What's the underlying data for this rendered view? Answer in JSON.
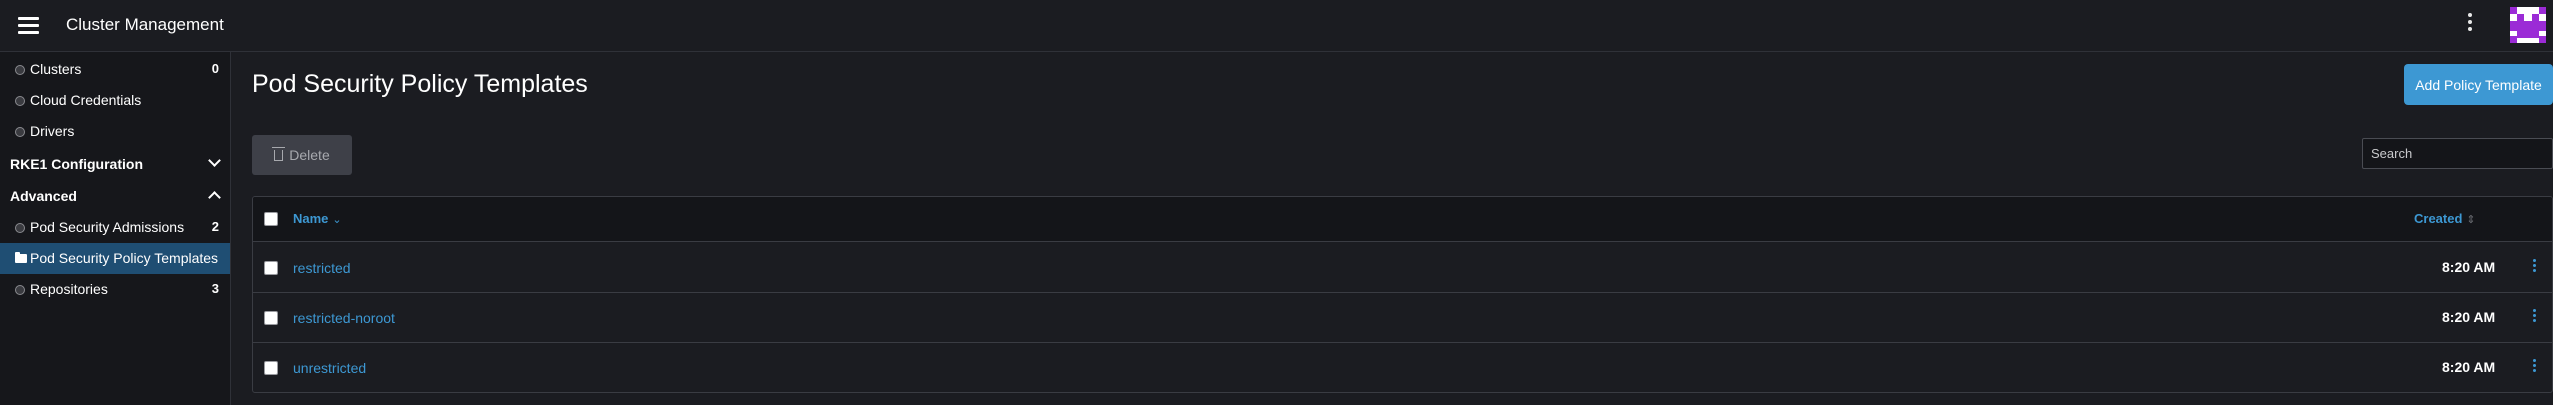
{
  "header": {
    "title": "Cluster Management",
    "menu_icon": "hamburger-icon",
    "more_icon": "kebab-icon",
    "avatar_color": "#9b2bd6"
  },
  "sidebar": {
    "items_top": [
      {
        "label": "Clusters",
        "count": "0"
      },
      {
        "label": "Cloud Credentials",
        "count": ""
      },
      {
        "label": "Drivers",
        "count": ""
      }
    ],
    "group_rke1": {
      "label": "RKE1 Configuration",
      "state": "collapsed"
    },
    "group_advanced": {
      "label": "Advanced",
      "state": "expanded"
    },
    "items_advanced": [
      {
        "label": "Pod Security Admissions",
        "count": "2"
      },
      {
        "label": "Pod Security Policy Templates",
        "count": "",
        "active": true
      },
      {
        "label": "Repositories",
        "count": "3"
      }
    ]
  },
  "main": {
    "title": "Pod Security Policy Templates",
    "add_button": "Add Policy Template",
    "delete_button": "Delete",
    "search_placeholder": "Search",
    "accent": "#3d98d3"
  },
  "table": {
    "columns": {
      "name": "Name",
      "created": "Created"
    },
    "rows": [
      {
        "name": "restricted",
        "created": "8:20 AM"
      },
      {
        "name": "restricted-noroot",
        "created": "8:20 AM"
      },
      {
        "name": "unrestricted",
        "created": "8:20 AM"
      }
    ]
  }
}
